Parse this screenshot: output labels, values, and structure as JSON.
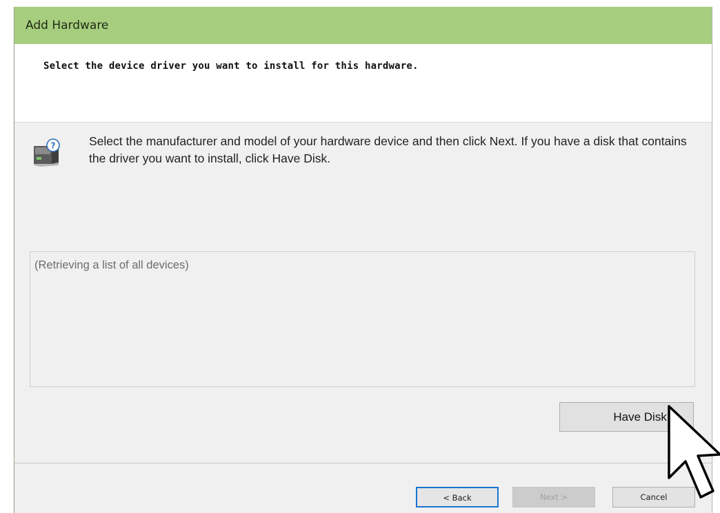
{
  "window": {
    "title": "Add Hardware"
  },
  "header": {
    "text": "Select the device driver you want to install for this hardware."
  },
  "body": {
    "instructions": "Select the manufacturer and model of your hardware device and then click Next. If you have a disk that contains the driver you want to install, click Have Disk.",
    "icon": "hardware-question-icon"
  },
  "device_list": {
    "status_text": "(Retrieving a list of all devices)"
  },
  "buttons": {
    "have_disk": "Have Disk...",
    "back": "< Back",
    "next": "Next >",
    "cancel": "Cancel"
  },
  "colors": {
    "titlebar": "#a6ce7e",
    "focus_border": "#1a73d1"
  },
  "cursor": {
    "icon": "mouse-pointer-icon"
  }
}
